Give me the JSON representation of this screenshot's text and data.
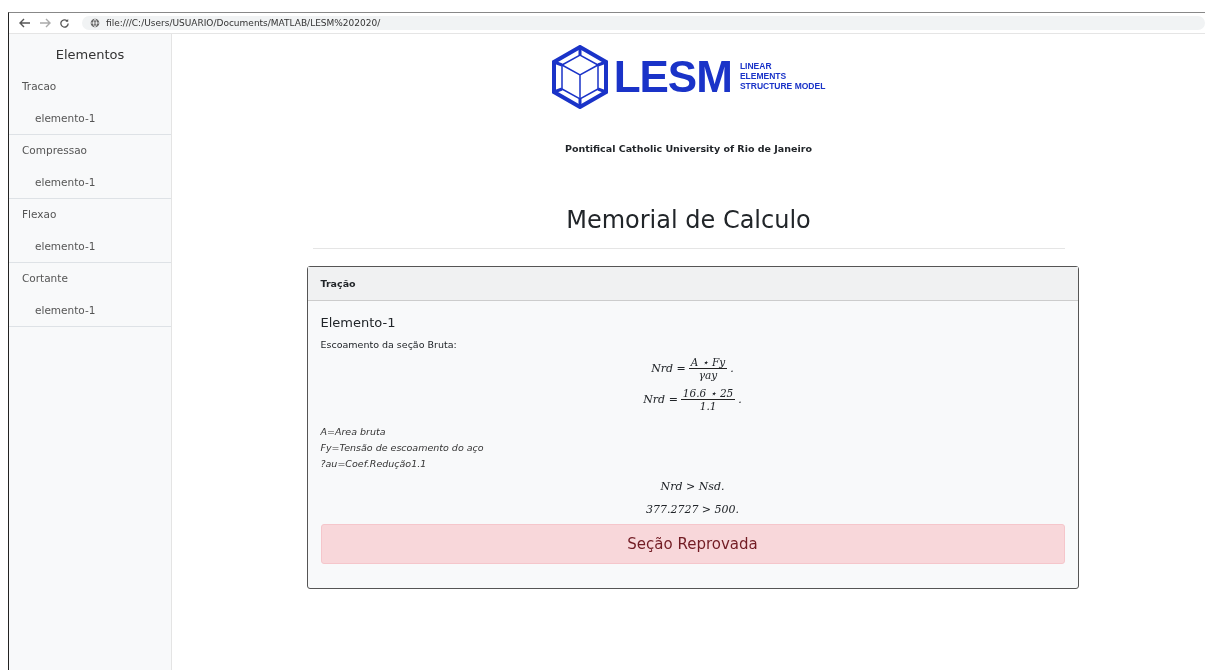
{
  "browser": {
    "url": "file:///C:/Users/USUARIO/Documents/MATLAB/LESM%202020/"
  },
  "sidebar": {
    "title": "Elementos",
    "groups": [
      {
        "label": "Tracao",
        "items": [
          {
            "label": "elemento-1"
          }
        ]
      },
      {
        "label": "Compressao",
        "items": [
          {
            "label": "elemento-1"
          }
        ]
      },
      {
        "label": "Flexao",
        "items": [
          {
            "label": "elemento-1"
          }
        ]
      },
      {
        "label": "Cortante",
        "items": [
          {
            "label": "elemento-1"
          }
        ]
      }
    ]
  },
  "logo": {
    "wordmark": "LESM",
    "tagline": [
      "LINEAR",
      "ELEMENTS",
      "STRUCTURE MODEL"
    ]
  },
  "university": "Pontifical Catholic University of Rio de Janeiro",
  "heading": "Memorial de Calculo",
  "card": {
    "header": "Tração",
    "title": "Elemento-1",
    "intro": "Escoamento da seção Bruta:",
    "formulas": [
      {
        "kind": "fraction",
        "lhs": "Nrd =",
        "numerator": "A ⋆ Fy",
        "denominator": "γay",
        "end": "."
      },
      {
        "kind": "fraction",
        "lhs": "Nrd =",
        "numerator": "16.6 ⋆ 25",
        "denominator": "1.1",
        "end": "."
      }
    ],
    "legend": [
      "A=Area bruta",
      "Fy=Tensão de escoamento do aço",
      "?au=Coef.Redução1.1"
    ],
    "checks": [
      {
        "kind": "line",
        "text": "Nrd > Nsd."
      },
      {
        "kind": "line",
        "text": "377.2727 > 500."
      }
    ],
    "result": {
      "text": "Seção Reprovada",
      "passed": false
    }
  }
}
